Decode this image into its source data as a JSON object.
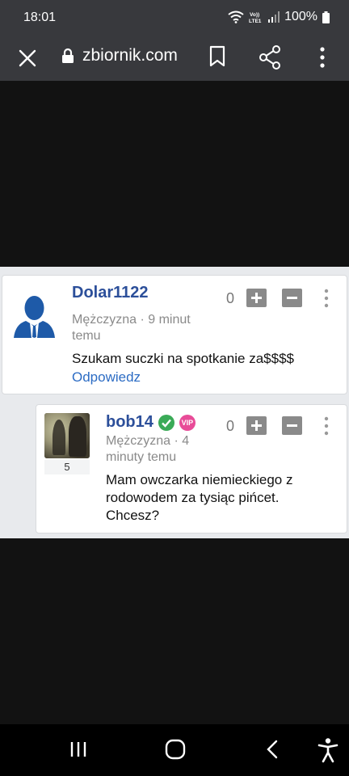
{
  "status_bar": {
    "time": "18:01",
    "network_label": "VoLTE1",
    "battery": "100%"
  },
  "browser": {
    "url": "zbiornik.com"
  },
  "comments": [
    {
      "username": "Dolar1122",
      "meta": "Mężczyzna · 9 minut temu",
      "text": "Szukam suczki na spotkanie za$$$$",
      "score": "0",
      "reply_label": "Odpowiedz"
    },
    {
      "username": "bob14",
      "vip_label": "VIP",
      "avatar_count": "5",
      "meta": "Mężczyzna · 4 minuty temu",
      "text": "Mam owczarka niemieckiego z rodowodem za tysiąc pińcet. Chcesz?",
      "score": "0"
    }
  ],
  "colors": {
    "chrome": "#38393d",
    "username": "#2c4f9a",
    "link": "#2c6cc4",
    "vip": "#e84c98",
    "verified": "#3aaa57"
  }
}
